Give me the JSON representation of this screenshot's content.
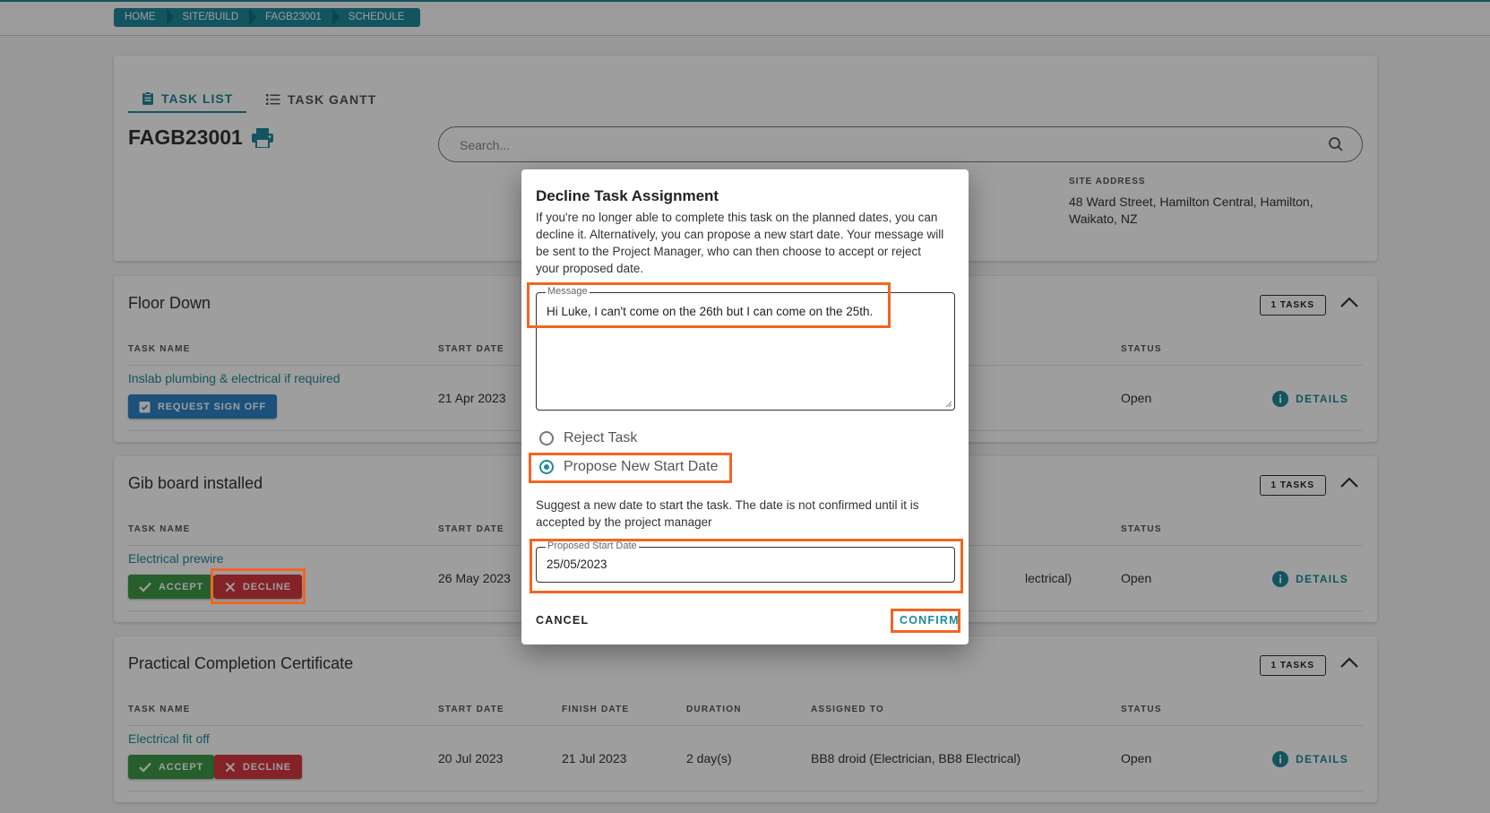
{
  "breadcrumb": [
    "HOME",
    "SITE/BUILD",
    "FAGB23001",
    "SCHEDULE"
  ],
  "tabs": [
    {
      "label": "TASK LIST",
      "icon": "clipboard-icon"
    },
    {
      "label": "TASK GANTT",
      "icon": "list-icon"
    }
  ],
  "job": {
    "title": "FAGB23001",
    "print_icon": "print-icon"
  },
  "search": {
    "placeholder": "Search..."
  },
  "site": {
    "label": "SITE ADDRESS",
    "value": "48 Ward Street, Hamilton Central, Hamilton, Waikato, NZ"
  },
  "columns": {
    "task_name": "TASK NAME",
    "start_date": "START DATE",
    "finish_date": "FINISH DATE",
    "duration": "DURATION",
    "assigned_to": "ASSIGNED TO",
    "status": "STATUS"
  },
  "groups": [
    {
      "title": "Floor Down",
      "badge": "1 TASKS",
      "task": "Inslab plumbing & electrical if required",
      "start": "21 Apr 2023",
      "status": "Open",
      "button": "REQUEST SIGN OFF",
      "details": "DETAILS"
    },
    {
      "title": "Gib board installed",
      "badge": "1 TASKS",
      "task": "Electrical prewire",
      "start": "26 May 2023",
      "assigned_tail": "lectrical)",
      "status": "Open",
      "accept": "ACCEPT",
      "decline": "DECLINE",
      "details": "DETAILS"
    },
    {
      "title": "Practical Completion Certificate",
      "badge": "1 TASKS",
      "task": "Electrical fit off",
      "start": "20 Jul 2023",
      "finish": "21 Jul 2023",
      "duration": "2 day(s)",
      "assigned": "BB8 droid (Electrician, BB8 Electrical)",
      "status": "Open",
      "accept": "ACCEPT",
      "decline": "DECLINE",
      "details": "DETAILS"
    }
  ],
  "dialog": {
    "title": "Decline Task Assignment",
    "description": "If you're no longer able to complete this task on the planned dates, you can decline it. Alternatively, you can propose a new start date. Your message will be sent to the Project Manager, who can then choose to accept or reject your proposed date.",
    "message_label": "Message",
    "message_value": "Hi Luke, I can't come on the 26th but I can come on the 25th.",
    "options": [
      "Reject Task",
      "Propose New Start Date"
    ],
    "selected_option": "Propose New Start Date",
    "date_hint": "Suggest a new date to start the task. The date is not confirmed until it is accepted by the project manager",
    "date_label": "Proposed Start Date",
    "date_value": "25/05/2023",
    "cancel": "CANCEL",
    "confirm": "CONFIRM"
  },
  "colors": {
    "accent": "#1e8a9c",
    "accept": "#3e9a47",
    "decline": "#d7383f",
    "request": "#2c83c5",
    "highlight": "#f26522"
  }
}
